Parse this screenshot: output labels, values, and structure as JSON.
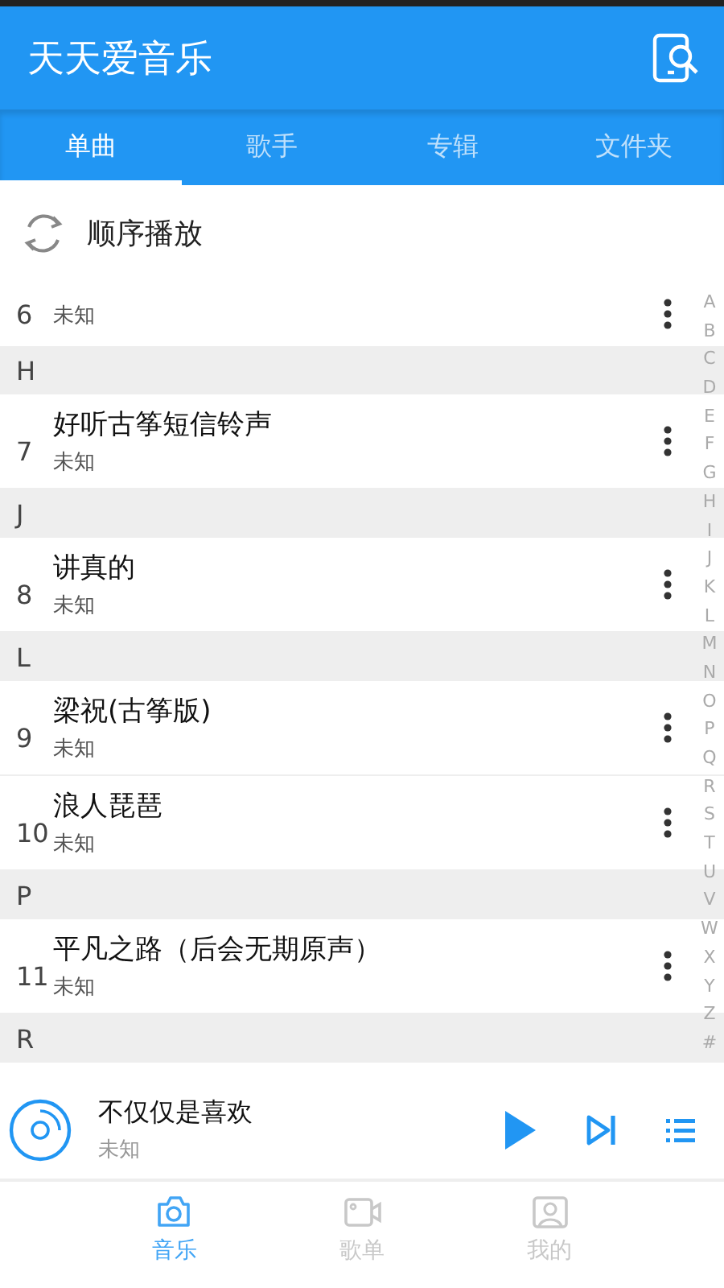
{
  "app_bar": {
    "title": "天天爱音乐"
  },
  "tabs": [
    {
      "label": "单曲",
      "selected": true
    },
    {
      "label": "歌手",
      "selected": false
    },
    {
      "label": "专辑",
      "selected": false
    },
    {
      "label": "文件夹",
      "selected": false
    }
  ],
  "play_mode": {
    "label": "顺序播放"
  },
  "list": [
    {
      "kind": "song",
      "number": "6",
      "artist": "未知"
    },
    {
      "kind": "header",
      "letter": "H"
    },
    {
      "kind": "song",
      "number": "7",
      "title": "好听古筝短信铃声",
      "artist": "未知"
    },
    {
      "kind": "header",
      "letter": "J"
    },
    {
      "kind": "song",
      "number": "8",
      "title": "讲真的",
      "artist": "未知"
    },
    {
      "kind": "header",
      "letter": "L"
    },
    {
      "kind": "song",
      "number": "9",
      "title": "梁祝(古筝版)",
      "artist": "未知"
    },
    {
      "kind": "song",
      "number": "10",
      "title": "浪人琵琶",
      "artist": "未知"
    },
    {
      "kind": "header",
      "letter": "P"
    },
    {
      "kind": "song",
      "number": "11",
      "title": "平凡之路（后会无期原声）",
      "artist": "未知"
    },
    {
      "kind": "header",
      "letter": "R"
    }
  ],
  "index_bar": [
    "A",
    "B",
    "C",
    "D",
    "E",
    "F",
    "G",
    "H",
    "I",
    "J",
    "K",
    "L",
    "M",
    "N",
    "O",
    "P",
    "Q",
    "R",
    "S",
    "T",
    "U",
    "V",
    "W",
    "X",
    "Y",
    "Z",
    "#"
  ],
  "now_playing": {
    "title": "不仅仅是喜欢",
    "artist": "未知"
  },
  "bottom_nav": [
    {
      "label": "音乐",
      "selected": true
    },
    {
      "label": "歌单",
      "selected": false
    },
    {
      "label": "我的",
      "selected": false
    }
  ]
}
